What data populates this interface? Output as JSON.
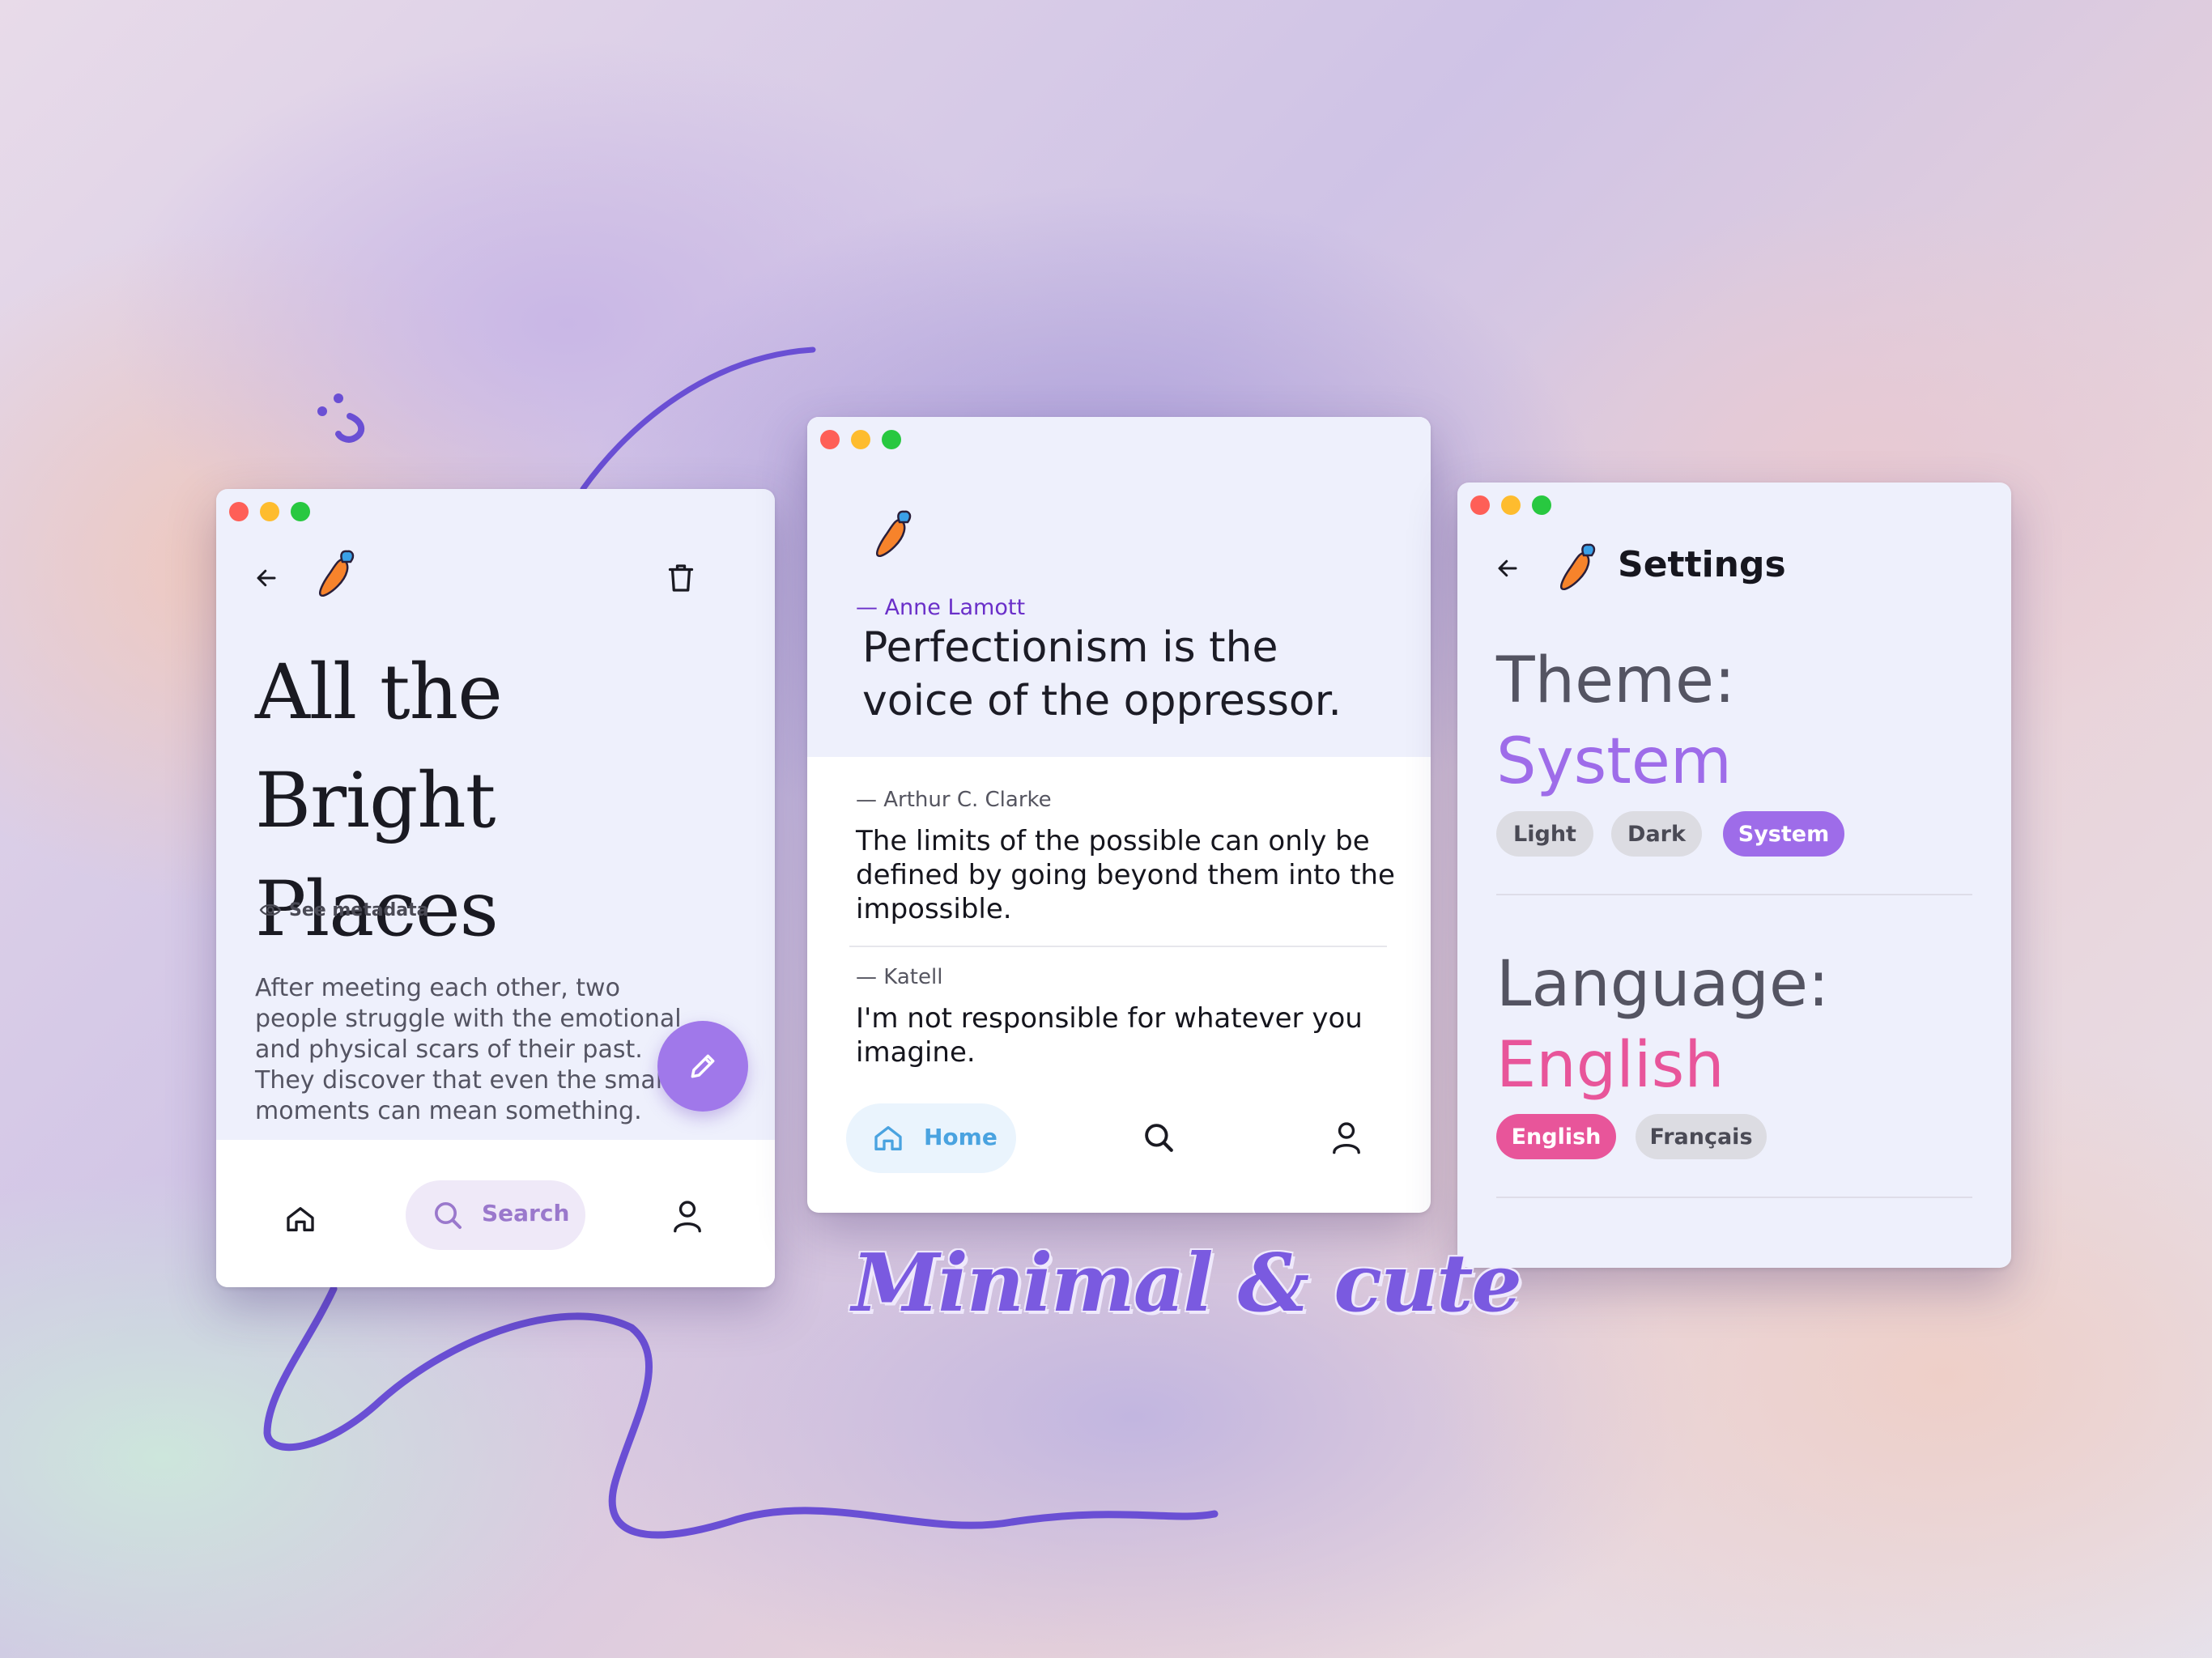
{
  "reader": {
    "title": "All the Bright Places",
    "see_metadata": "See metadata",
    "description": "After meeting each other, two people struggle with the emotional and physical scars of their past. They discover that even the smallest moments can mean something.",
    "nav": {
      "search_label": "Search"
    }
  },
  "quotes": {
    "featured": {
      "author": "— Anne Lamott",
      "text": "Perfectionism is the voice of the oppressor."
    },
    "items": [
      {
        "author": "— Arthur C. Clarke",
        "text": "The limits of the possible can only be defined by going beyond them into the impossible."
      },
      {
        "author": "— Katell",
        "text": "I'm not responsible for whatever you imagine."
      }
    ],
    "nav": {
      "home_label": "Home"
    }
  },
  "settings": {
    "title": "Settings",
    "theme_label": "Theme:",
    "theme_value": "System",
    "theme_options": [
      "Light",
      "Dark",
      "System"
    ],
    "language_label": "Language:",
    "language_value": "English",
    "language_options": [
      "English",
      "Français"
    ]
  },
  "tagline": "Minimal & cute",
  "colors": {
    "accent_purple": "#a078ea",
    "theme_value": "#9e6ce9",
    "language_pink": "#e8559a",
    "author_purple": "#6a2fc9",
    "home_blue": "#4aa3e0"
  },
  "icons": [
    "back-arrow-icon",
    "carrot-logo-icon",
    "trash-icon",
    "eye-icon",
    "pencil-icon",
    "home-icon",
    "search-icon",
    "user-icon"
  ]
}
